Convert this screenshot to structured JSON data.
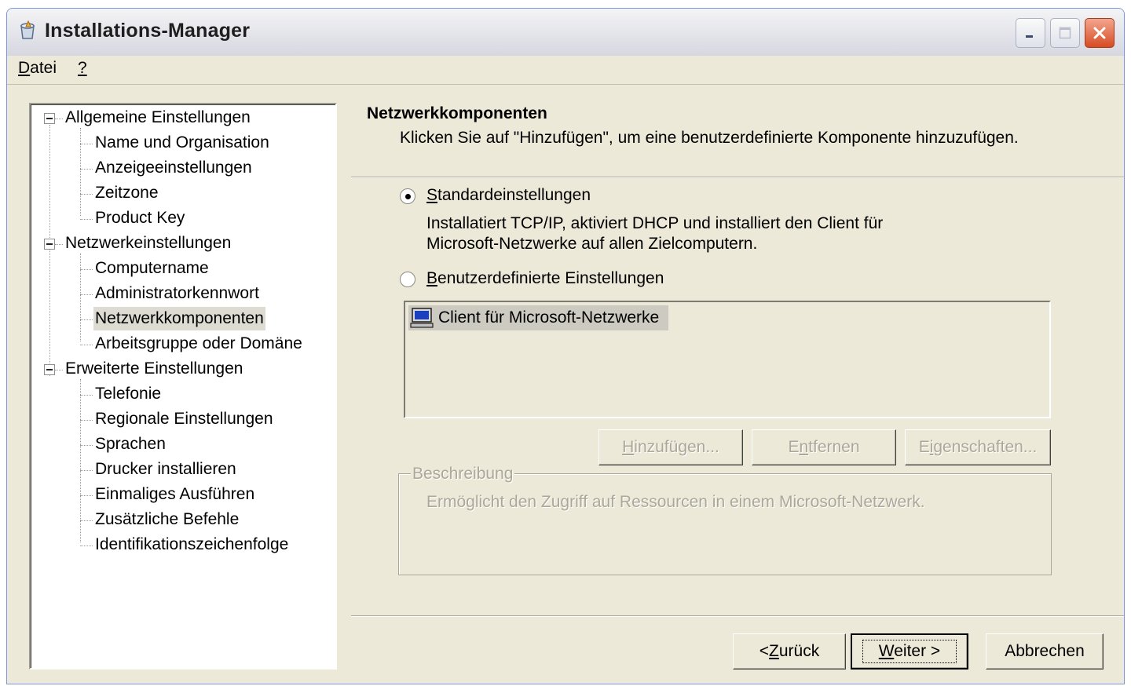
{
  "window": {
    "title": "Installations-Manager",
    "controls": {
      "minimize": "minimize",
      "maximize": "maximize",
      "close": "close"
    }
  },
  "menu": {
    "items": [
      {
        "label": "Datei",
        "accel": "D"
      },
      {
        "label": "?",
        "accel": "?"
      }
    ]
  },
  "tree": {
    "groups": [
      {
        "label": "Allgemeine Einstellungen",
        "children": [
          "Name und Organisation",
          "Anzeigeeinstellungen",
          "Zeitzone",
          "Product Key"
        ]
      },
      {
        "label": "Netzwerkeinstellungen",
        "children": [
          "Computername",
          "Administratorkennwort",
          "Netzwerkkomponenten",
          "Arbeitsgruppe oder Domäne"
        ]
      },
      {
        "label": "Erweiterte Einstellungen",
        "children": [
          "Telefonie",
          "Regionale Einstellungen",
          "Sprachen",
          "Drucker installieren",
          "Einmaliges Ausführen",
          "Zusätzliche Befehle",
          "Identifikationszeichenfolge"
        ]
      }
    ],
    "selected": "Netzwerkkomponenten"
  },
  "page": {
    "title": "Netzwerkkomponenten",
    "subtitle": "Klicken Sie auf \"Hinzufügen\", um eine benutzerdefinierte Komponente hinzuzufügen.",
    "options": {
      "standard": {
        "label": "Standardeinstellungen",
        "description_line1": "Installatiert TCP/IP, aktiviert DHCP und installiert den Client für",
        "description_line2": "Microsoft-Netzwerke auf allen Zielcomputern.",
        "checked": true
      },
      "custom": {
        "label": "Benutzerdefinierte Einstellungen",
        "checked": false
      }
    },
    "components": [
      {
        "label": "Client für Microsoft-Netzwerke",
        "icon": "computer-icon"
      }
    ],
    "component_buttons": {
      "add": "Hinzufügen...",
      "remove": "Entfernen",
      "properties": "Eigenschaften..."
    },
    "description": {
      "legend": "Beschreibung",
      "text": "Ermöglicht den Zugriff auf Ressourcen in einem Microsoft-Netzwerk."
    }
  },
  "nav_buttons": {
    "back": "< Zurück",
    "next": "Weiter >",
    "cancel": "Abbrechen"
  }
}
